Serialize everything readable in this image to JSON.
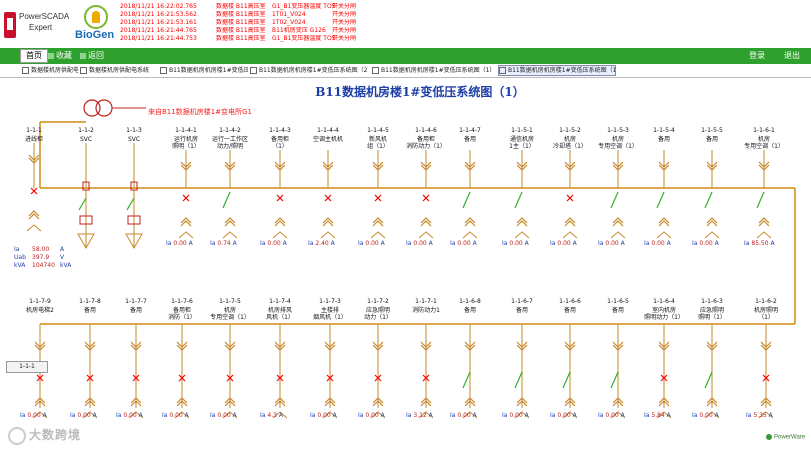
{
  "header": {
    "logo_powerscada_line1": "PowerSCADA",
    "logo_powerscada_line2": "Expert",
    "logo_biogen": "BioGen",
    "alarms": [
      {
        "time": "2018/11/21 16:22:02.765",
        "location": "数据楼 B11高压室",
        "message": "G1_B1变压器温度 TOS",
        "status": "开关分闸"
      },
      {
        "time": "2018/11/21 16:21:53.562",
        "location": "数据楼 B11高压室",
        "message": "1T01_V024",
        "status": "开关分闸"
      },
      {
        "time": "2018/11/21 16:21:53.161",
        "location": "数据楼 B11高压室",
        "message": "1T02_V024",
        "status": "开关分闸"
      },
      {
        "time": "2018/11/21 16:21:44.765",
        "location": "数据楼 B11高压室",
        "message": "B11机房变压 G126",
        "status": "开关分闸"
      },
      {
        "time": "2018/11/21 16:21:44.753",
        "location": "数据楼 B11高压室",
        "message": "G1_B1变压器温度 TOS",
        "status": "开关分闸"
      }
    ]
  },
  "nav": {
    "home": "首页",
    "favorites": "收藏",
    "back": "返回",
    "login": "登录",
    "logout": "退出"
  },
  "subtabs": [
    {
      "label": "数据楼机房供配电系统",
      "active": false
    },
    {
      "label": "数据楼机房供配电系统",
      "active": false
    },
    {
      "label": "B11数据机房机房楼1#变低压系统图",
      "active": false
    },
    {
      "label": "B11数据机房机房楼1#变低压系统图（2）",
      "active": false
    },
    {
      "label": "B11数据机房机房楼1#变低压系统图（1）",
      "active": false
    },
    {
      "label": "B11数据机房机房楼1#变低压系统图（1）",
      "active": true
    }
  ],
  "diagram": {
    "title": "B11数据机房楼1#变低压系统图（1）",
    "transformer_label": "来自B11数据机房楼1#变电所G1",
    "side_readout": [
      {
        "label": "Ia",
        "value": "58.00",
        "unit": "A"
      },
      {
        "label": "Uab",
        "value": "397.9",
        "unit": "V"
      },
      {
        "label": "kVA",
        "value": "104740",
        "unit": "kVA"
      }
    ],
    "page_button": "1-1-1",
    "top_feeders": [
      {
        "code": "1-1-1",
        "name": "进线柜",
        "value": ""
      },
      {
        "code": "1-1-2",
        "name": "SVC",
        "value": ""
      },
      {
        "code": "1-1-3",
        "name": "SVC",
        "value": ""
      },
      {
        "code": "1-1-4-1",
        "name": "运行机房\n照明（1）",
        "value": "0.00"
      },
      {
        "code": "1-1-4-2",
        "name": "运行一工作区\n动力/照明",
        "value": "0.74"
      },
      {
        "code": "1-1-4-3",
        "name": "备用柜\n（1）",
        "value": "0.00"
      },
      {
        "code": "1-1-4-4",
        "name": "空调主机机",
        "value": "2.40"
      },
      {
        "code": "1-1-4-5",
        "name": "新风机\n组（1）",
        "value": "0.00"
      },
      {
        "code": "1-1-4-6",
        "name": "备用柜\n消防动力（1）",
        "value": "0.00"
      },
      {
        "code": "1-1-4-7",
        "name": "备用",
        "value": "0.00"
      },
      {
        "code": "1-1-5-1",
        "name": "通信机房\n1主（1）",
        "value": "0.00"
      },
      {
        "code": "1-1-5-2",
        "name": "机房\n冷却塔（1）",
        "value": "0.00"
      },
      {
        "code": "1-1-5-3",
        "name": "机房\n专用空调（1）",
        "value": "0.00"
      },
      {
        "code": "1-1-5-4",
        "name": "备用",
        "value": "0.00"
      },
      {
        "code": "1-1-5-5",
        "name": "备用",
        "value": "0.00"
      },
      {
        "code": "1-1-6-1",
        "name": "机房\n专用空调（1）",
        "value": "85.50"
      }
    ],
    "bottom_feeders": [
      {
        "code": "1-1-7-9",
        "name": "机房电梯2",
        "value": "0.00"
      },
      {
        "code": "1-1-7-8",
        "name": "备用",
        "value": "0.00"
      },
      {
        "code": "1-1-7-7",
        "name": "备用",
        "value": "0.00"
      },
      {
        "code": "1-1-7-6",
        "name": "备用柜\n消防（1）",
        "value": "0.00"
      },
      {
        "code": "1-1-7-5",
        "name": "机房\n专用空调（1）",
        "value": "0.00"
      },
      {
        "code": "1-1-7-4",
        "name": "机房排风\n风机（1）",
        "value": "4.3"
      },
      {
        "code": "1-1-7-3",
        "name": "主楼排\n烟风机（1）",
        "value": "0.00"
      },
      {
        "code": "1-1-7-2",
        "name": "应急照明\n动力（1）",
        "value": "0.00"
      },
      {
        "code": "1-1-7-1",
        "name": "消防动力1",
        "value": "3.12"
      },
      {
        "code": "1-1-6-8",
        "name": "备用",
        "value": "0.00"
      },
      {
        "code": "1-1-6-7",
        "name": "备用",
        "value": "0.00"
      },
      {
        "code": "1-1-6-6",
        "name": "备用",
        "value": "0.00"
      },
      {
        "code": "1-1-6-5",
        "name": "备用",
        "value": "0.00"
      },
      {
        "code": "1-1-6-4",
        "name": "室内机房\n照明动力（1）",
        "value": "5.84"
      },
      {
        "code": "1-1-6-3",
        "name": "应急照明\n照明（1）",
        "value": "0.00"
      },
      {
        "code": "1-1-6-2",
        "name": "机房照明\n（1）",
        "value": "5.35"
      }
    ],
    "current_label": "Ia",
    "current_unit": "A"
  },
  "footer": {
    "watermark": "大数跨境",
    "brand": "PowerWare"
  },
  "colors": {
    "bus": "#d28a12",
    "breaker": "#c58a2a",
    "closed_mark": "#ff0000",
    "open_blade": "#2bb32b",
    "nav_green": "#2ea02e"
  }
}
